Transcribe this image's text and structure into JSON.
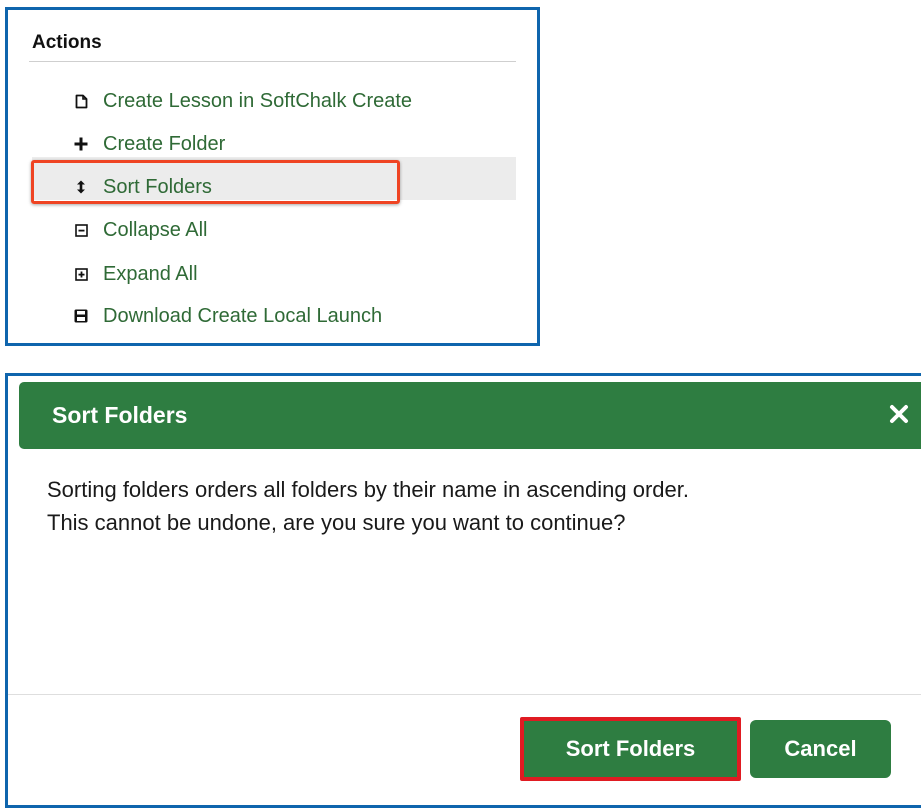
{
  "actions": {
    "heading": "Actions",
    "items": [
      {
        "label": "Create Lesson in SoftChalk Create",
        "icon": "new-document-icon"
      },
      {
        "label": "Create Folder",
        "icon": "plus-icon"
      },
      {
        "label": "Sort Folders",
        "icon": "sort-arrows-icon"
      },
      {
        "label": "Collapse All",
        "icon": "collapse-square-icon"
      },
      {
        "label": "Expand All",
        "icon": "expand-square-icon"
      },
      {
        "label": "Download Create Local Launch",
        "icon": "save-disk-icon"
      }
    ],
    "highlighted_item": "Sort Folders"
  },
  "dialog": {
    "title": "Sort Folders",
    "close_icon": "close-icon",
    "body_line_1": "Sorting folders orders all folders by their name in ascending order.",
    "body_line_2": "This cannot be undone, are you sure you want to continue?",
    "confirm_label": "Sort Folders",
    "cancel_label": "Cancel"
  },
  "colors": {
    "frame_border": "#0f65ad",
    "link_green": "#2f6a36",
    "header_green": "#2e7d41",
    "annotation_red": "#ef4423"
  }
}
